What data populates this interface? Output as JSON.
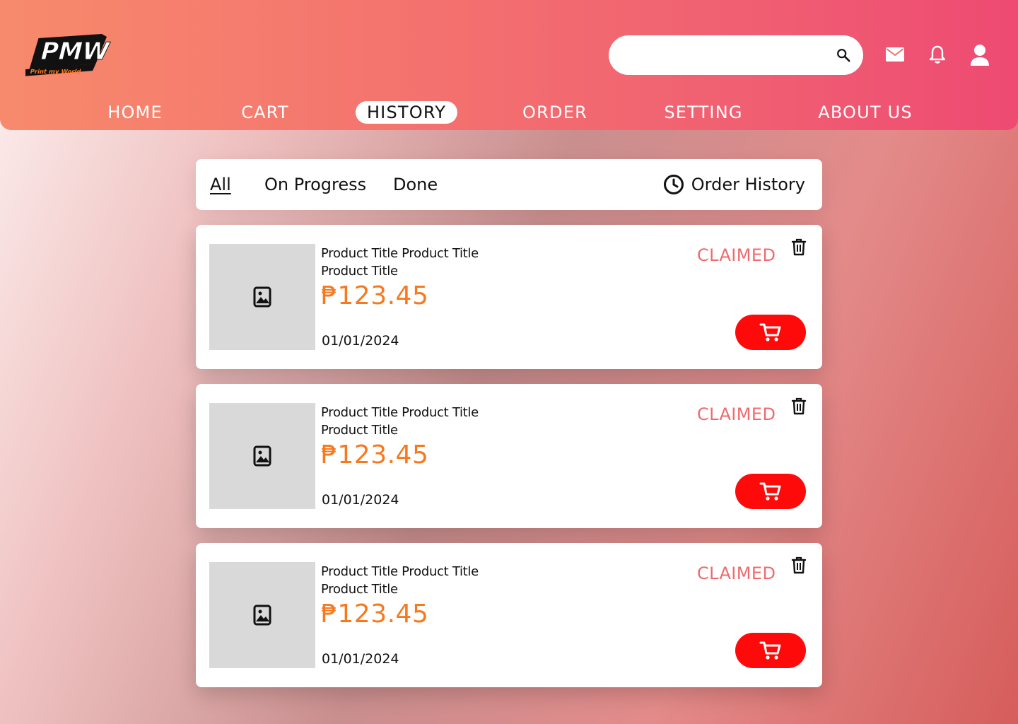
{
  "brand": {
    "logo_text": "PMW",
    "logo_tagline": "Print my World"
  },
  "search": {
    "placeholder": "",
    "value": ""
  },
  "nav": {
    "items": [
      {
        "label": "HOME"
      },
      {
        "label": "CART"
      },
      {
        "label": "HISTORY",
        "active": true
      },
      {
        "label": "ORDER"
      },
      {
        "label": "SETTING"
      },
      {
        "label": "ABOUT US"
      }
    ]
  },
  "filters": {
    "tabs": [
      {
        "label": "All",
        "active": true
      },
      {
        "label": "On Progress"
      },
      {
        "label": "Done"
      }
    ],
    "history_label": "Order History"
  },
  "orders": [
    {
      "title": "Product Title Product Title Product Title",
      "price": "₱123.45",
      "date": "01/01/2024",
      "status": "CLAIMED"
    },
    {
      "title": "Product Title Product Title Product Title",
      "price": "₱123.45",
      "date": "01/01/2024",
      "status": "CLAIMED"
    },
    {
      "title": "Product Title Product Title Product Title",
      "price": "₱123.45",
      "date": "01/01/2024",
      "status": "CLAIMED"
    }
  ],
  "colors": {
    "header_gradient_start": "#f78a6c",
    "header_gradient_end": "#ee4a72",
    "price": "#f7791e",
    "status": "#f06a6d",
    "cart_button": "#ff0a0a",
    "thumbnail": "#d9d9d9"
  },
  "icons": {
    "header": [
      "search-icon",
      "mail-icon",
      "bell-icon",
      "user-icon"
    ],
    "filter": "clock-icon",
    "card": [
      "image-placeholder-icon",
      "trash-icon",
      "cart-icon"
    ]
  }
}
